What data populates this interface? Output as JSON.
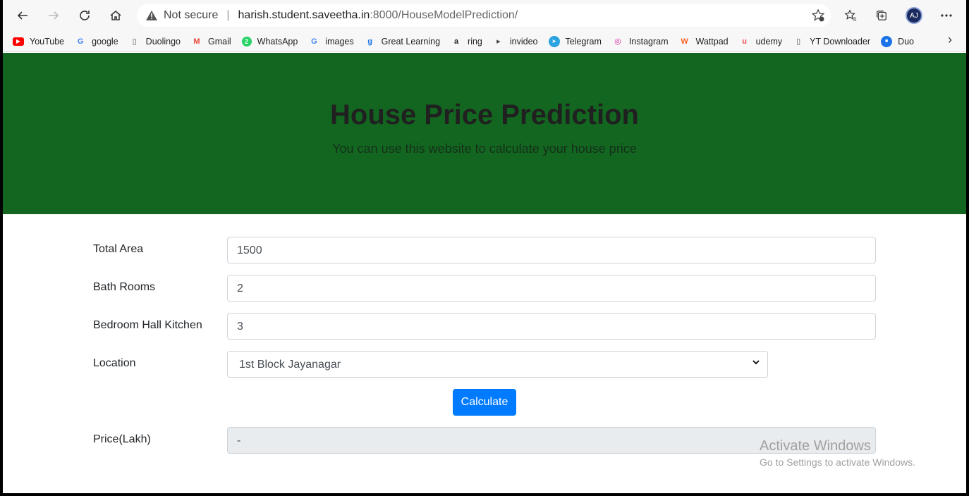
{
  "browser": {
    "address": {
      "security_label": "Not secure",
      "url_host": "harish.student.saveetha.in",
      "url_rest": ":8000/HouseModelPrediction/"
    },
    "bookmarks": [
      {
        "label": "YouTube",
        "icon": "youtube-icon",
        "color": "#ff0000"
      },
      {
        "label": "google",
        "icon": "google-icon",
        "color": "#4285f4"
      },
      {
        "label": "Duolingo",
        "icon": "page-icon",
        "color": "#555555"
      },
      {
        "label": "Gmail",
        "icon": "gmail-icon",
        "color": "#ea4335"
      },
      {
        "label": "WhatsApp",
        "icon": "whatsapp-icon",
        "color": "#25d366"
      },
      {
        "label": "images",
        "icon": "google-icon",
        "color": "#4285f4"
      },
      {
        "label": "Great Learning",
        "icon": "great-learning-icon",
        "color": "#1a73e8"
      },
      {
        "label": "ring",
        "icon": "amazon-icon",
        "color": "#222222"
      },
      {
        "label": "invideo",
        "icon": "invideo-icon",
        "color": "#444444"
      },
      {
        "label": "Telegram",
        "icon": "telegram-icon",
        "color": "#2aa3e0"
      },
      {
        "label": "Instagram",
        "icon": "instagram-icon",
        "color": "#d6249f"
      },
      {
        "label": "Wattpad",
        "icon": "wattpad-icon",
        "color": "#ff6122"
      },
      {
        "label": "udemy",
        "icon": "udemy-icon",
        "color": "#ec5252"
      },
      {
        "label": "YT Downloader",
        "icon": "page-icon",
        "color": "#555555"
      },
      {
        "label": "Duo",
        "icon": "duo-icon",
        "color": "#1a73e8"
      }
    ]
  },
  "page": {
    "title": "House Price Prediction",
    "subtitle": "You can use this website to calculate your house price",
    "form": {
      "total_area": {
        "label": "Total Area",
        "value": "1500"
      },
      "bath_rooms": {
        "label": "Bath Rooms",
        "value": "2"
      },
      "bhk": {
        "label": "Bedroom Hall Kitchen",
        "value": "3"
      },
      "location": {
        "label": "Location",
        "value": "1st Block Jayanagar"
      },
      "calculate_label": "Calculate",
      "price": {
        "label": "Price(Lakh)",
        "value": "-"
      }
    },
    "colors": {
      "header_bg": "#136620",
      "button": "#007bff"
    }
  },
  "watermark": {
    "title": "Activate Windows",
    "subtitle": "Go to Settings to activate Windows."
  }
}
